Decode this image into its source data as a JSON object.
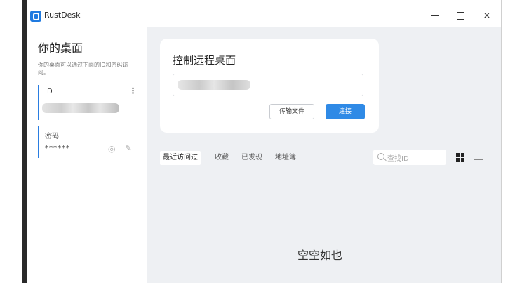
{
  "window": {
    "title": "RustDesk",
    "controls": {
      "minimize": "minimize-icon",
      "maximize": "maximize-icon",
      "close": "×"
    }
  },
  "sidebar": {
    "title": "你的桌面",
    "description": "你的桌面可以通过下面的ID和密码访问。",
    "id_label": "ID",
    "id_more": "⋮",
    "password_label": "密码",
    "password_value": "******",
    "eye_icon": "◎",
    "edit_icon": "✎"
  },
  "control_card": {
    "title": "控制远程桌面",
    "transfer_button": "传输文件",
    "connect_button": "连接"
  },
  "tabs": [
    {
      "label": "最近访问过",
      "active": true
    },
    {
      "label": "收藏"
    },
    {
      "label": "已发现"
    },
    {
      "label": "地址簿"
    }
  ],
  "search": {
    "placeholder": "查找ID"
  },
  "empty_message": "空空如也",
  "colors": {
    "accent": "#2f8ae6",
    "main_bg": "#eef0f3"
  }
}
